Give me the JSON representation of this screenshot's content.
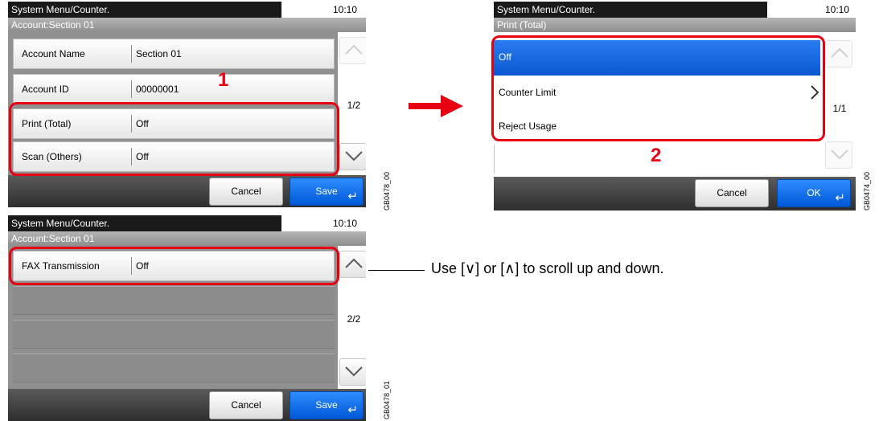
{
  "colors": {
    "accent_red": "#e60012",
    "selected_blue": "#0a63e6",
    "titlebar": "#1a1a1a"
  },
  "screen1": {
    "title": "System Menu/Counter.",
    "time": "10:10",
    "subtitle": "Account:Section 01",
    "rows": [
      {
        "label": "Account Name",
        "value": "Section 01"
      },
      {
        "label": "Account ID",
        "value": "00000001"
      },
      {
        "label": "Print (Total)",
        "value": "Off"
      },
      {
        "label": "Scan (Others)",
        "value": "Off"
      }
    ],
    "page": "1/2",
    "cancel": "Cancel",
    "save": "Save",
    "code": "GB0478_00",
    "callout": "1"
  },
  "screen2": {
    "title": "System Menu/Counter.",
    "time": "10:10",
    "subtitle": "Print (Total)",
    "options": [
      {
        "label": "Off",
        "selected": true
      },
      {
        "label": "Counter Limit",
        "selected": false
      },
      {
        "label": "Reject Usage",
        "selected": false
      }
    ],
    "page": "1/1",
    "cancel": "Cancel",
    "ok": "OK",
    "code": "GB0474_00",
    "callout": "2"
  },
  "screen3": {
    "title": "System Menu/Counter.",
    "time": "10:10",
    "subtitle": "Account:Section 01",
    "rows": [
      {
        "label": "FAX Transmission",
        "value": "Off"
      }
    ],
    "page": "2/2",
    "cancel": "Cancel",
    "save": "Save",
    "code": "GB0478_01"
  },
  "note": "Use [∨] or [∧] to scroll up and down.",
  "icons": [
    "chevron-up-icon",
    "chevron-down-icon",
    "chevron-right-icon",
    "enter-icon",
    "right-arrow-icon"
  ]
}
